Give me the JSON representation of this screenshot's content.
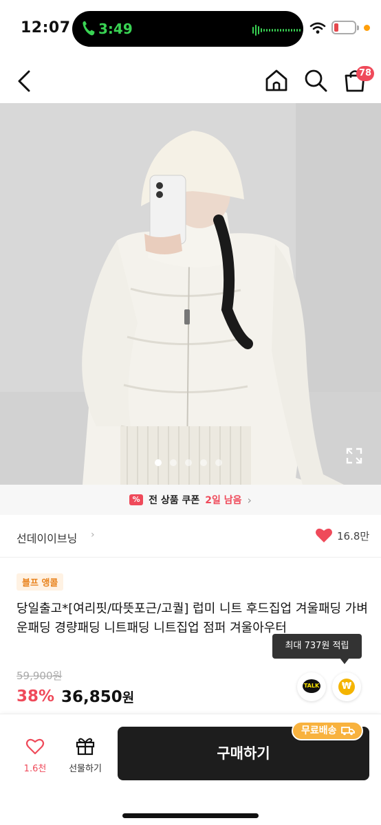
{
  "status_bar": {
    "time": "12:07",
    "call_time": "3:49",
    "battery_color": "#e5484d",
    "call_color": "#39d353"
  },
  "nav": {
    "cart_count": "78"
  },
  "carousel": {
    "total": 5,
    "active": 1
  },
  "coupon": {
    "text": "전 상품 쿠폰",
    "highlight": "2일 남음",
    "accent": "#ef4a5a"
  },
  "seller": {
    "name": "선데이이브닝",
    "likes": "16.8만"
  },
  "product": {
    "badge": "블프 앵콜",
    "title": "당일출고*[여리핏/따뜻포근/고퀄] 럽미 니트 후드집업 겨울패딩 가벼운패딩 경량패딩 니트패딩 니트집업 점퍼 겨울아우터",
    "original_price": "59,900원",
    "discount": "38%",
    "price": "36,850",
    "price_unit": "원",
    "reward_tooltip": "최대 737원 적립",
    "talk_label": "TALK",
    "reward_symbol": "₩"
  },
  "bottom": {
    "wish_count": "1.6천",
    "gift_label": "선물하기",
    "buy_label": "구매하기",
    "free_shipping": "무료배송"
  }
}
